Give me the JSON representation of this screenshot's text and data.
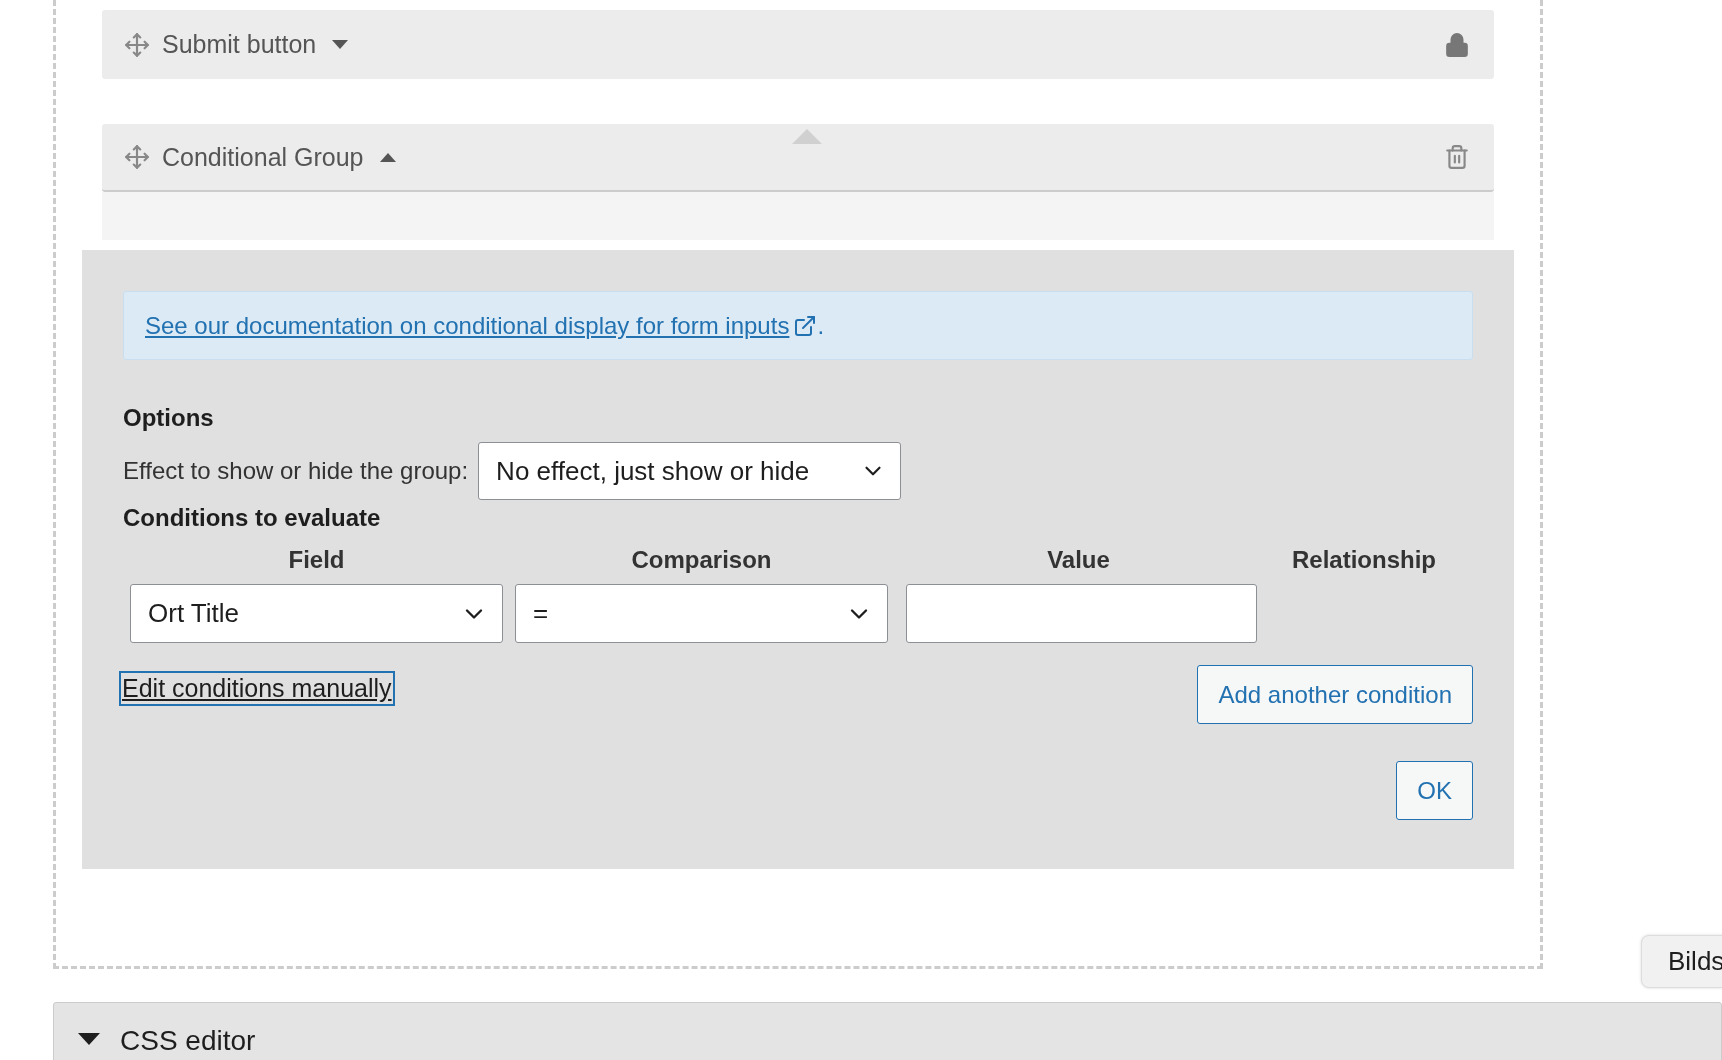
{
  "blocks": [
    {
      "title": "Submit button",
      "expanded": false,
      "kind": "lock"
    },
    {
      "title": "Conditional Group",
      "expanded": true,
      "kind": "delete"
    }
  ],
  "conditional_panel": {
    "doc_link": "See our documentation on conditional display for form inputs",
    "doc_suffix": ".",
    "options_heading": "Options",
    "effect_label": "Effect to show or hide the group:",
    "effect_value": "No effect, just show or hide",
    "conditions_heading": "Conditions to evaluate",
    "columns": [
      "Field",
      "Comparison",
      "Value",
      "Relationship"
    ],
    "condition": {
      "field": "Ort Title",
      "comparison": "="
    },
    "edit_link": "Edit conditions manually",
    "add_button": "Add another condition",
    "ok_button": "OK"
  },
  "tooltip": "Bilds",
  "css_editor": {
    "title": "CSS editor",
    "expanded": true
  }
}
